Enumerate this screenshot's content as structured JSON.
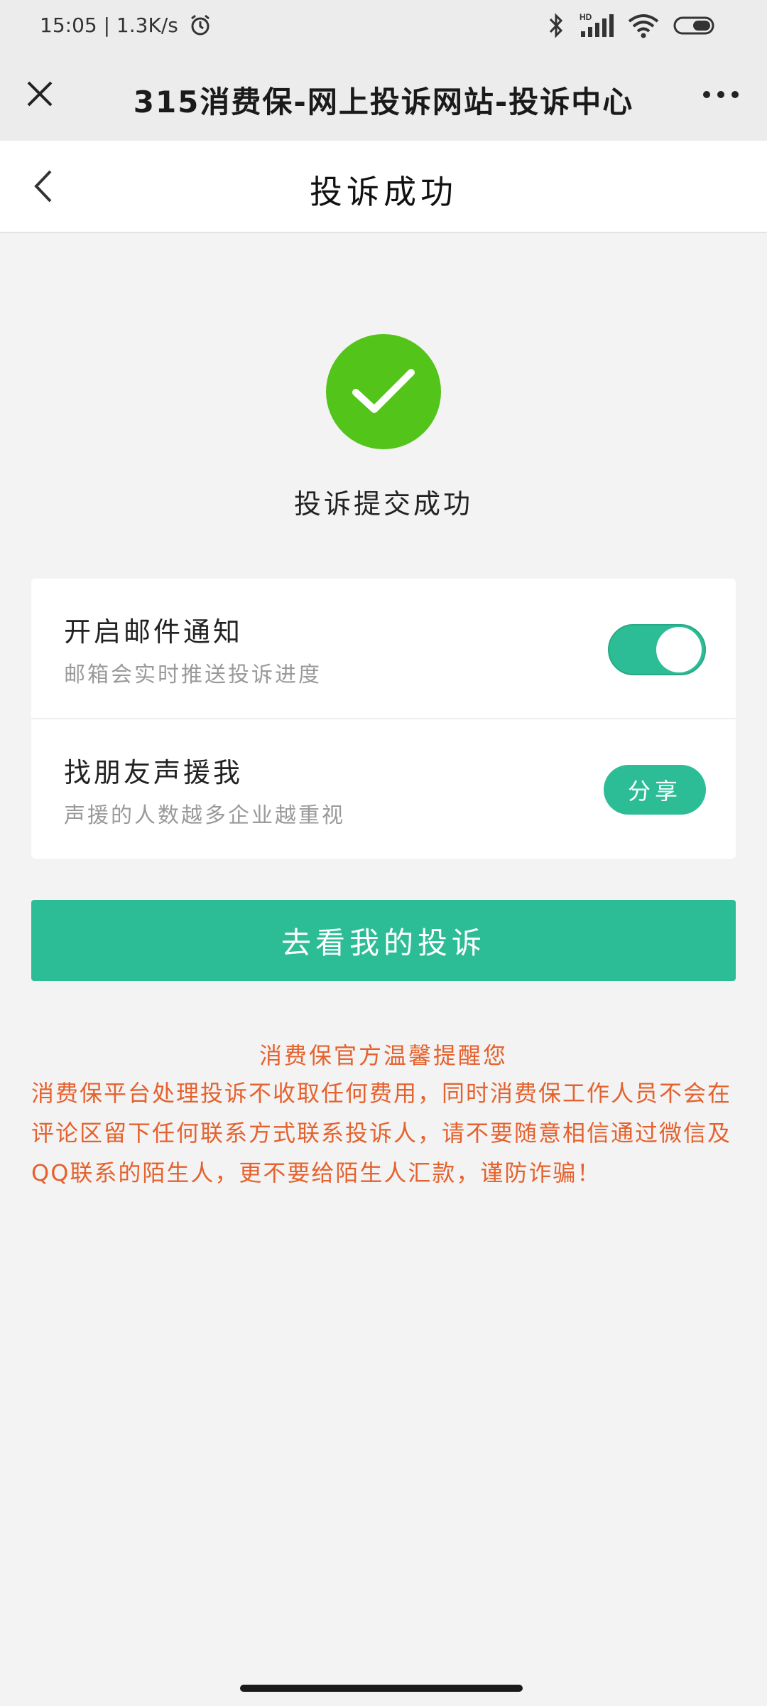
{
  "status_bar": {
    "time_speed": "15:05 | 1.3K/s",
    "icons": [
      "alarm-icon",
      "bluetooth-icon",
      "signal-icon",
      "wifi-icon",
      "battery-icon"
    ]
  },
  "webview": {
    "title": "315消费保-网上投诉网站-投诉中心"
  },
  "header": {
    "title": "投诉成功"
  },
  "success": {
    "message": "投诉提交成功"
  },
  "options": {
    "email_title": "开启邮件通知",
    "email_sub": "邮箱会实时推送投诉进度",
    "email_toggle_on": true,
    "friends_title": "找朋友声援我",
    "friends_sub": "声援的人数越多企业越重视",
    "share_label": "分享"
  },
  "primary_button": "去看我的投诉",
  "notice": {
    "title": "消费保官方温馨提醒您",
    "body": "消费保平台处理投诉不收取任何费用，同时消费保工作人员不会在评论区留下任何联系方式联系投诉人，请不要随意相信通过微信及QQ联系的陌生人，更不要给陌生人汇款，谨防诈骗！"
  },
  "colors": {
    "accent": "#2dbd96",
    "success": "#52c41a",
    "warning_text": "#e5622e"
  }
}
